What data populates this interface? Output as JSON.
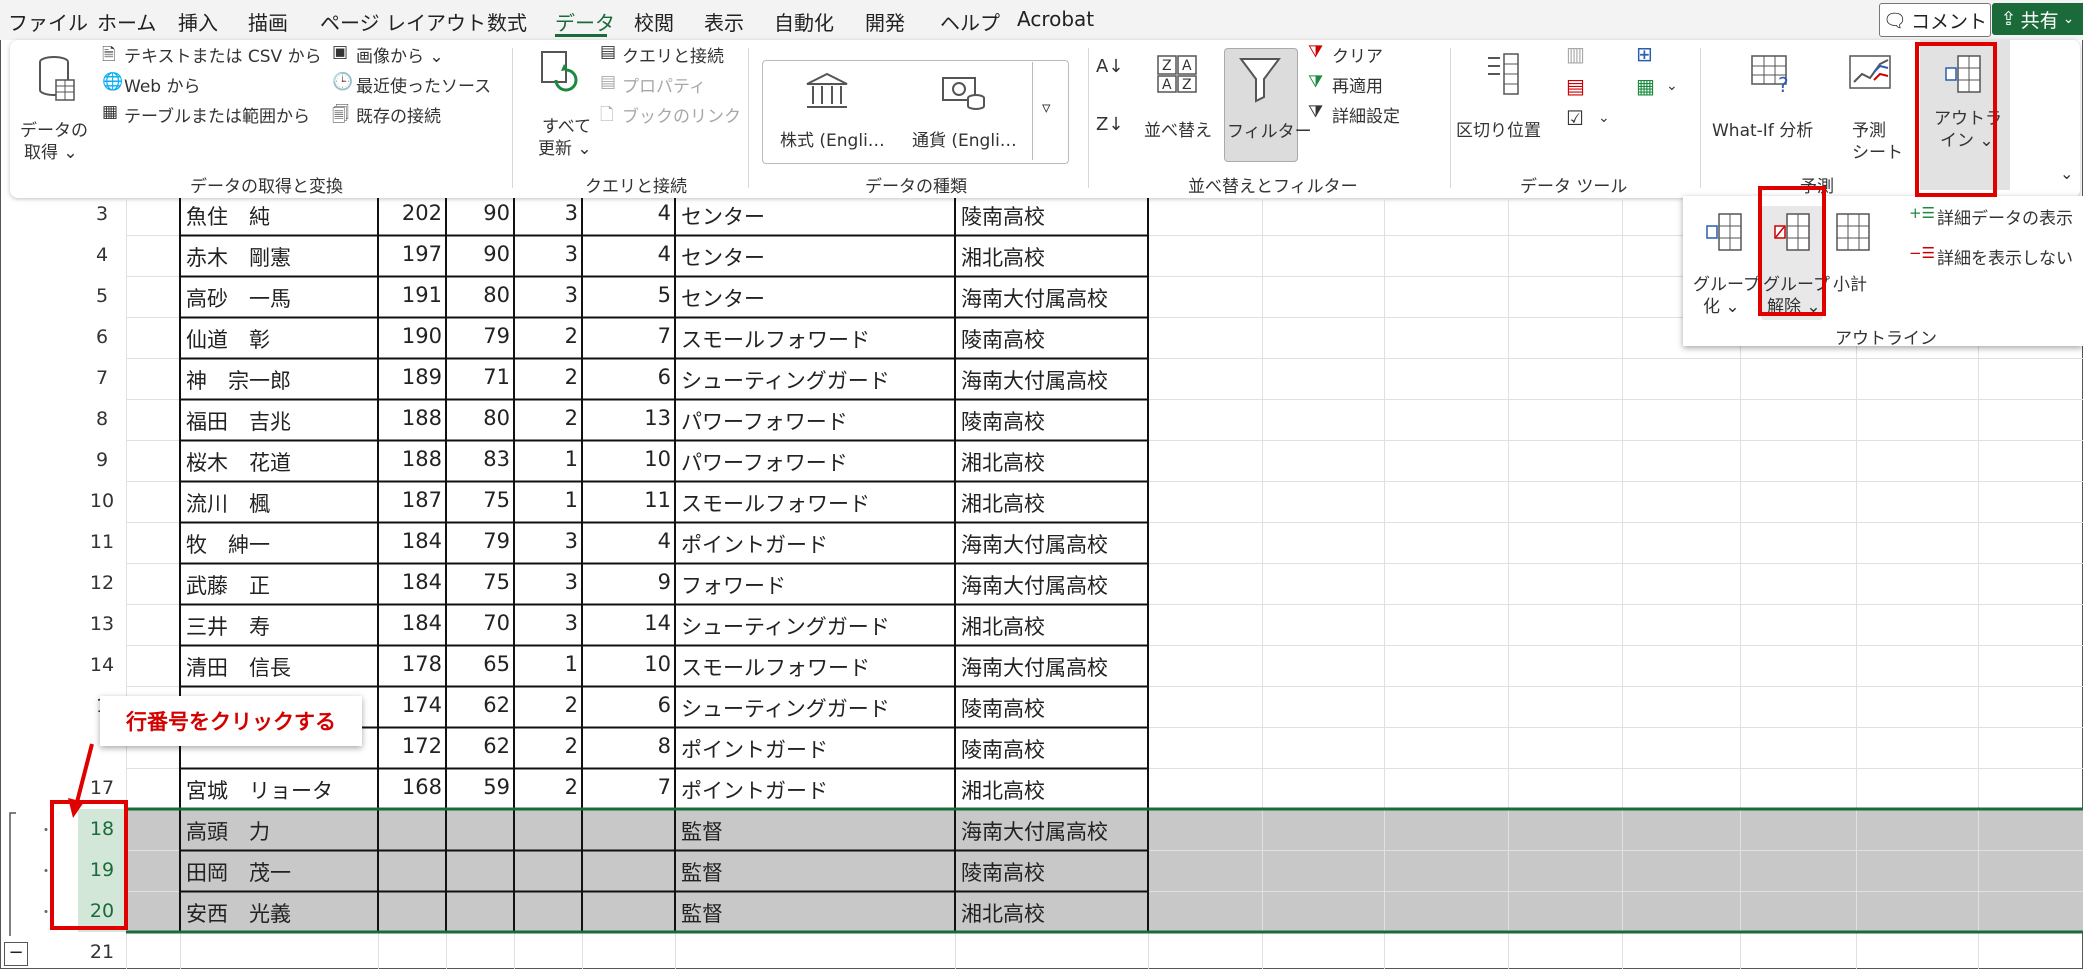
{
  "menu": [
    "ファイル",
    "ホーム",
    "挿入",
    "描画",
    "ページ レイアウト",
    "数式",
    "データ",
    "校閲",
    "表示",
    "自動化",
    "開発",
    "ヘルプ",
    "Acrobat"
  ],
  "active_menu": "データ",
  "comment_label": "コメント",
  "share_label": "共有",
  "ribbon": {
    "get_data": {
      "line1": "データの",
      "line2": "取得 ⌄"
    },
    "text_csv": "テキストまたは CSV から",
    "web": "Web から",
    "table_range": "テーブルまたは範囲から",
    "image": "画像から ⌄",
    "recent": "最近使ったソース",
    "existing": "既存の接続",
    "group1": "データの取得と変換",
    "refresh_all": {
      "line1": "すべて",
      "line2": "更新 ⌄"
    },
    "queries_conn": "クエリと接続",
    "properties": "プロパティ",
    "book_link": "ブックのリンク",
    "group2": "クエリと接続",
    "stocks": "株式 (Engli…",
    "currency": "通貨 (Engli…",
    "group3": "データの種類",
    "sort": "並べ替え",
    "filter": "フィルター",
    "clear": "クリア",
    "reapply": "再適用",
    "advanced": "詳細設定",
    "group4": "並べ替えとフィルター",
    "text_to_cols": "区切り位置",
    "group5": "データ ツール",
    "whatif": "What-If 分析",
    "forecast": {
      "line1": "予測",
      "line2": "シート"
    },
    "group6": "予測",
    "outline": {
      "line1": "アウトラ",
      "line2": "イン ⌄"
    }
  },
  "outline_popup": {
    "group": {
      "line1": "グループ",
      "line2": "化 ⌄"
    },
    "ungroup": {
      "line1": "グループ",
      "line2": "解除 ⌄"
    },
    "subtotal": "小計",
    "show_detail": "詳細データの表示",
    "hide_detail": "詳細を表示しない",
    "label": "アウトライン"
  },
  "callout": "行番号をクリックする",
  "rows": [
    {
      "r": "3",
      "name": "魚住　純",
      "h": "202",
      "w": "90",
      "g": "3",
      "n": "4",
      "pos": "センター",
      "school": "陵南高校"
    },
    {
      "r": "4",
      "name": "赤木　剛憲",
      "h": "197",
      "w": "90",
      "g": "3",
      "n": "4",
      "pos": "センター",
      "school": "湘北高校"
    },
    {
      "r": "5",
      "name": "高砂　一馬",
      "h": "191",
      "w": "80",
      "g": "3",
      "n": "5",
      "pos": "センター",
      "school": "海南大付属高校"
    },
    {
      "r": "6",
      "name": "仙道　彰",
      "h": "190",
      "w": "79",
      "g": "2",
      "n": "7",
      "pos": "スモールフォワード",
      "school": "陵南高校"
    },
    {
      "r": "7",
      "name": "神　宗一郎",
      "h": "189",
      "w": "71",
      "g": "2",
      "n": "6",
      "pos": "シューティングガード",
      "school": "海南大付属高校"
    },
    {
      "r": "8",
      "name": "福田　吉兆",
      "h": "188",
      "w": "80",
      "g": "2",
      "n": "13",
      "pos": "パワーフォワード",
      "school": "陵南高校"
    },
    {
      "r": "9",
      "name": "桜木　花道",
      "h": "188",
      "w": "83",
      "g": "1",
      "n": "10",
      "pos": "パワーフォワード",
      "school": "湘北高校"
    },
    {
      "r": "10",
      "name": "流川　楓",
      "h": "187",
      "w": "75",
      "g": "1",
      "n": "11",
      "pos": "スモールフォワード",
      "school": "湘北高校"
    },
    {
      "r": "11",
      "name": "牧　紳一",
      "h": "184",
      "w": "79",
      "g": "3",
      "n": "4",
      "pos": "ポイントガード",
      "school": "海南大付属高校"
    },
    {
      "r": "12",
      "name": "武藤　正",
      "h": "184",
      "w": "75",
      "g": "3",
      "n": "9",
      "pos": "フォワード",
      "school": "海南大付属高校"
    },
    {
      "r": "13",
      "name": "三井　寿",
      "h": "184",
      "w": "70",
      "g": "3",
      "n": "14",
      "pos": "シューティングガード",
      "school": "湘北高校"
    },
    {
      "r": "14",
      "name": "清田　信長",
      "h": "178",
      "w": "65",
      "g": "1",
      "n": "10",
      "pos": "スモールフォワード",
      "school": "海南大付属高校"
    },
    {
      "r": "1",
      "name": "",
      "h": "174",
      "w": "62",
      "g": "2",
      "n": "6",
      "pos": "シューティングガード",
      "school": "陵南高校"
    },
    {
      "r": "",
      "name": "",
      "h": "172",
      "w": "62",
      "g": "2",
      "n": "8",
      "pos": "ポイントガード",
      "school": "陵南高校"
    },
    {
      "r": "17",
      "name": "宮城　リョータ",
      "h": "168",
      "w": "59",
      "g": "2",
      "n": "7",
      "pos": "ポイントガード",
      "school": "湘北高校"
    },
    {
      "r": "18",
      "name": "高頭　力",
      "h": "",
      "w": "",
      "g": "",
      "n": "",
      "pos": "監督",
      "school": "海南大付属高校"
    },
    {
      "r": "19",
      "name": "田岡　茂一",
      "h": "",
      "w": "",
      "g": "",
      "n": "",
      "pos": "監督",
      "school": "陵南高校"
    },
    {
      "r": "20",
      "name": "安西　光義",
      "h": "",
      "w": "",
      "g": "",
      "n": "",
      "pos": "監督",
      "school": "湘北高校"
    },
    {
      "r": "21",
      "name": "",
      "h": "",
      "w": "",
      "g": "",
      "n": "",
      "pos": "",
      "school": ""
    }
  ],
  "selected_rows": [
    "18",
    "19",
    "20"
  ],
  "outline_minus": "−",
  "colors": {
    "excel_green": "#1b6b3a",
    "highlight_red": "#e00000",
    "selection_gray": "#c8c8c8"
  }
}
